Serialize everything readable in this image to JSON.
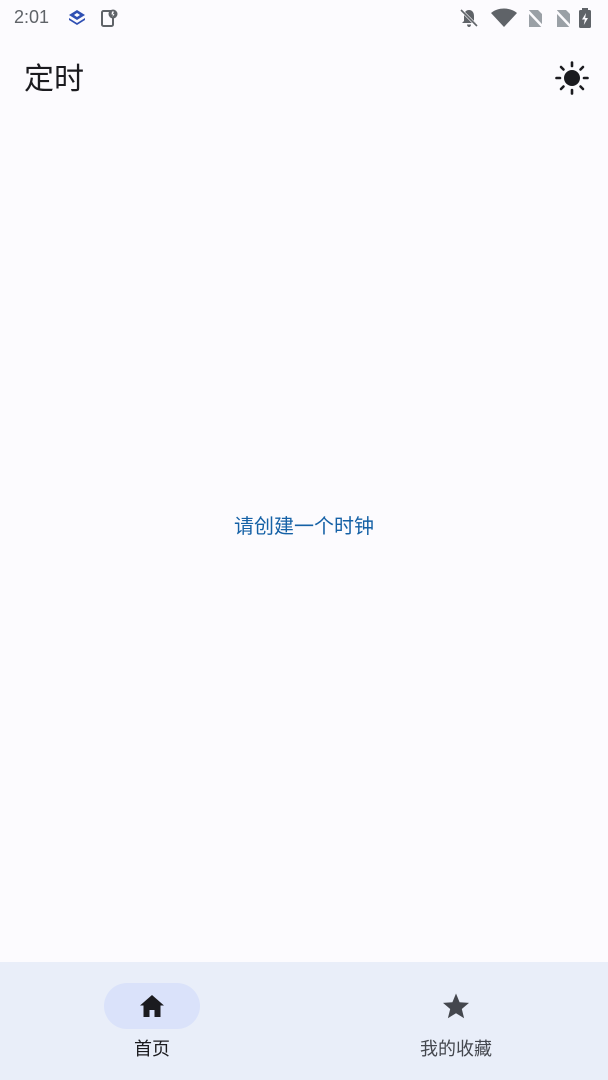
{
  "status_bar": {
    "time": "2:01",
    "icons": [
      "app-notification-icon",
      "clipboard-icon",
      "bell-off-icon",
      "wifi-icon",
      "no-sim-icon",
      "no-sim-icon",
      "battery-charging-icon"
    ]
  },
  "app_bar": {
    "title": "定时",
    "action_icon": "brightness-icon"
  },
  "main": {
    "empty_message": "请创建一个时钟"
  },
  "bottom_nav": {
    "items": [
      {
        "label": "首页",
        "icon": "home-icon",
        "selected": true
      },
      {
        "label": "我的收藏",
        "icon": "star-icon",
        "selected": false
      }
    ]
  },
  "colors": {
    "background": "#fcfbfe",
    "accent_text": "#1561a6",
    "nav_background": "#e9eef9",
    "nav_indicator": "#dae2fa",
    "on_surface": "#1b1b1f"
  }
}
